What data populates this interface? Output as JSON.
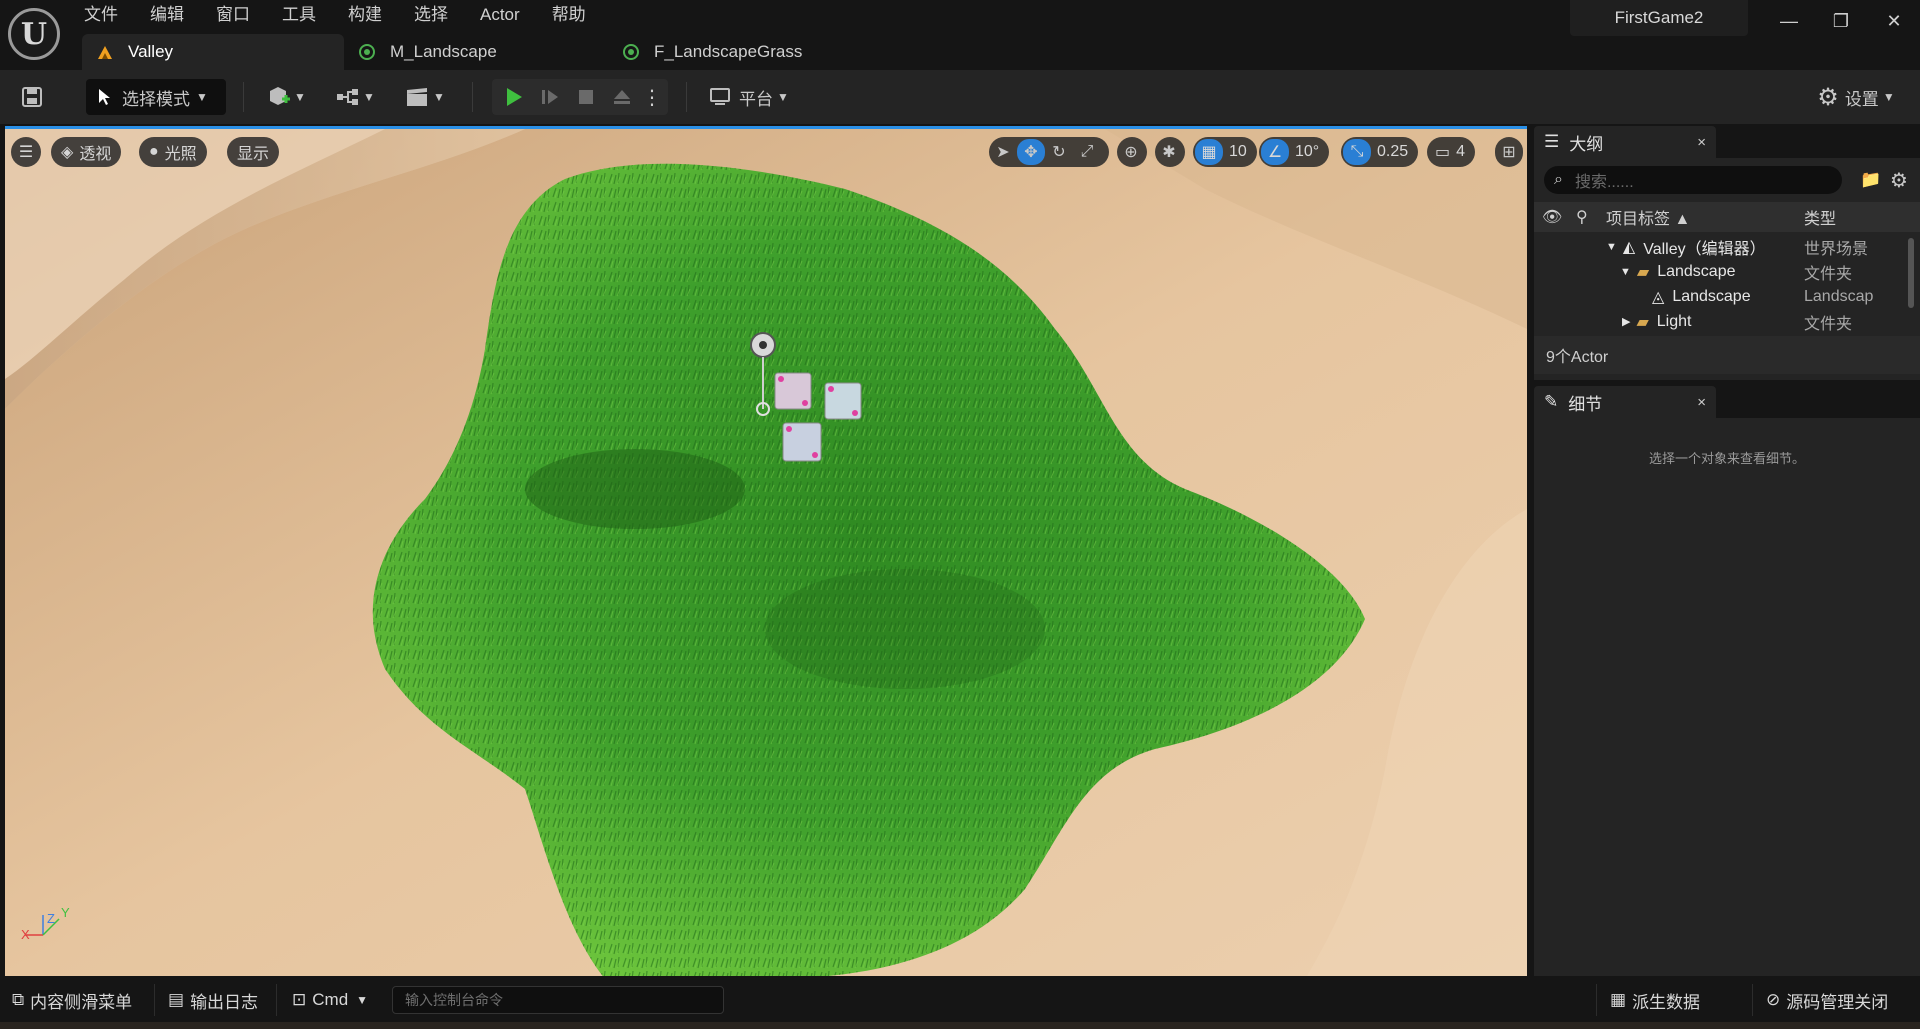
{
  "menu": [
    "文件",
    "编辑",
    "窗口",
    "工具",
    "构建",
    "选择",
    "Actor",
    "帮助"
  ],
  "tabs": [
    {
      "label": "Valley",
      "icon": "level-icon"
    },
    {
      "label": "M_Landscape",
      "icon": "material-icon"
    },
    {
      "label": "F_LandscapeGrass",
      "icon": "foliage-icon"
    }
  ],
  "project_name": "FirstGame2",
  "toolbar": {
    "mode_label": "选择模式",
    "platform_label": "平台",
    "settings_label": "设置"
  },
  "viewport": {
    "menu_icon": "hamburger-icon",
    "perspective_label": "透视",
    "lighting_label": "光照",
    "show_label": "显示",
    "grid_snap_value": "10",
    "rotation_snap_value": "10°",
    "scale_snap_value": "0.25",
    "camera_speed_value": "4",
    "axis_x": "X",
    "axis_y": "Y",
    "axis_z": "Z"
  },
  "outliner": {
    "title": "大纲",
    "close": "×",
    "search_placeholder": "搜索......",
    "col_label": "项目标签 ▲",
    "col_type": "类型",
    "rows": [
      {
        "label": "Valley（编辑器）",
        "type": "世界场景"
      },
      {
        "label": "Landscape",
        "type": "文件夹"
      },
      {
        "label": "Landscape",
        "type": "Landscap"
      },
      {
        "label": "Light",
        "type": "文件夹"
      }
    ],
    "actor_count": "9个Actor"
  },
  "details": {
    "title": "细节",
    "close": "×",
    "empty_message": "选择一个对象来查看细节。"
  },
  "statusbar": {
    "content_drawer": "内容侧滑菜单",
    "output_log": "输出日志",
    "cmd_label": "Cmd",
    "cmd_placeholder": "输入控制台命令",
    "derived_data": "派生数据",
    "source_control": "源码管理关闭"
  },
  "colors": {
    "accent": "#2a7fd4",
    "play_green": "#3fbf3f",
    "sand": "#e7c8a2",
    "grass": "#3a9a2a"
  }
}
